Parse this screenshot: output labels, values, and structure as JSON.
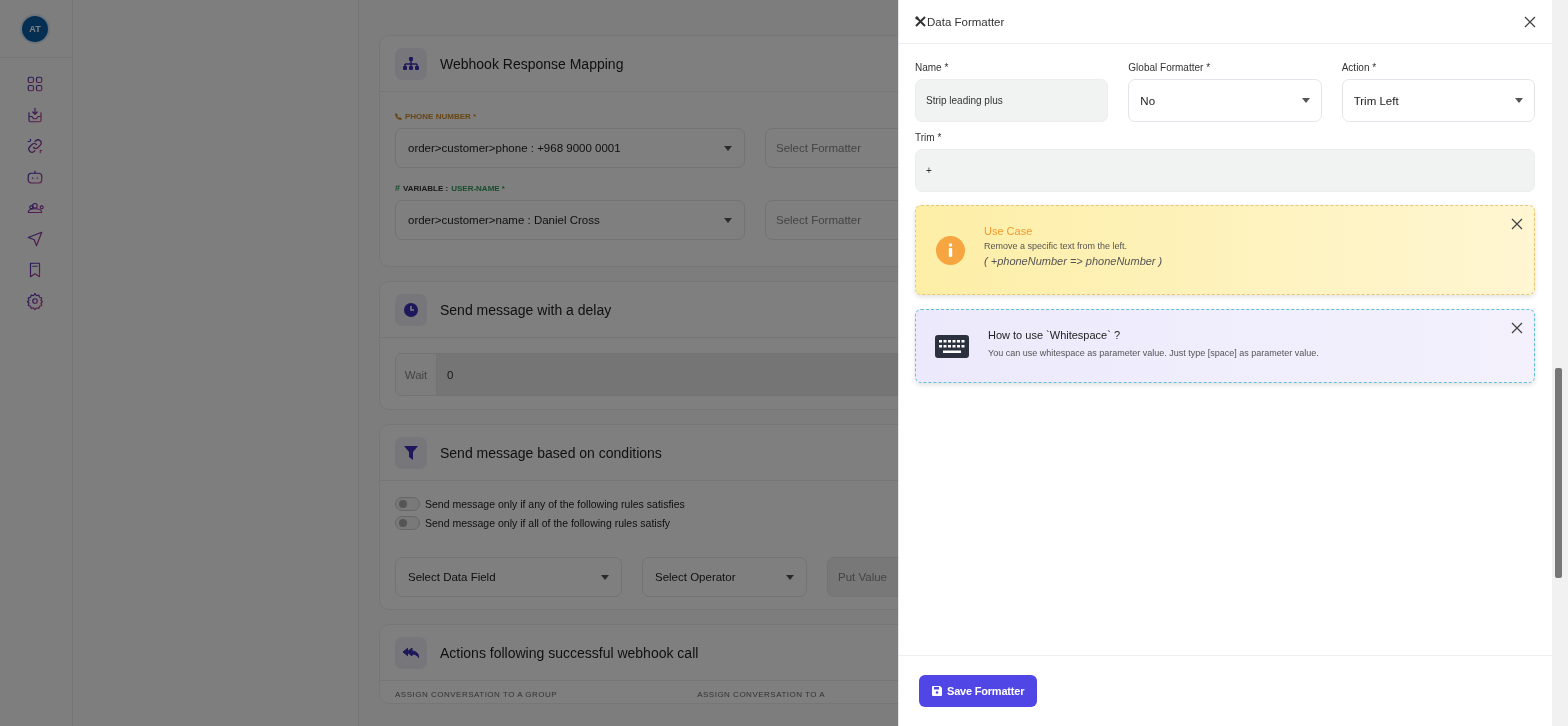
{
  "sidebar": {
    "avatar": "AT"
  },
  "sections": [
    {
      "kind": "mapping",
      "title": "Webhook Response Mapping",
      "fields": [
        {
          "kind": "phone",
          "label": "PHONE NUMBER *",
          "value": "order>customer>phone : +968 9000 0001",
          "formatter_placeholder": "Select Formatter"
        },
        {
          "kind": "variable",
          "marker": "#",
          "label_prefix": "VARIABLE :",
          "label": "USER-NAME *",
          "value": "order>customer>name : Daniel Cross",
          "formatter_placeholder": "Select Formatter"
        }
      ]
    },
    {
      "kind": "delay",
      "title": "Send message with a delay",
      "addon": "Wait",
      "value": "0"
    },
    {
      "kind": "conditions",
      "title": "Send message based on conditions",
      "toggles": [
        {
          "label": "Send message only if any of the following rules satisfies",
          "on": false
        },
        {
          "label": "Send message only if all of the following rules satisfy",
          "on": false
        }
      ],
      "data_field": "Select Data Field",
      "operator": "Select Operator",
      "value_placeholder": "Put Value"
    },
    {
      "kind": "actions",
      "title": "Actions following successful webhook call",
      "columns": [
        "ASSIGN CONVERSATION TO A GROUP",
        "ASSIGN CONVERSATION TO A"
      ]
    }
  ],
  "drawer": {
    "title": "Data Formatter",
    "rows": [
      [
        {
          "kind": "input",
          "label": "Name *",
          "value": "Strip leading plus"
        },
        {
          "kind": "select",
          "label": "Global Formatter *",
          "value": "No"
        },
        {
          "kind": "select",
          "label": "Action *",
          "value": "Trim Left"
        }
      ],
      [
        {
          "kind": "input",
          "label": "Trim *",
          "value": "+"
        }
      ]
    ],
    "notes": [
      {
        "kind": "warning",
        "title": "Use Case",
        "text": "Remove a specific text from the left.",
        "example": "( +phoneNumber => phoneNumber )"
      },
      {
        "kind": "hint",
        "title": "How to use `Whitespace` ?",
        "text": "You can use whitespace as parameter value. Just type [space] as parameter value."
      }
    ],
    "save_button": "Save Formatter"
  }
}
